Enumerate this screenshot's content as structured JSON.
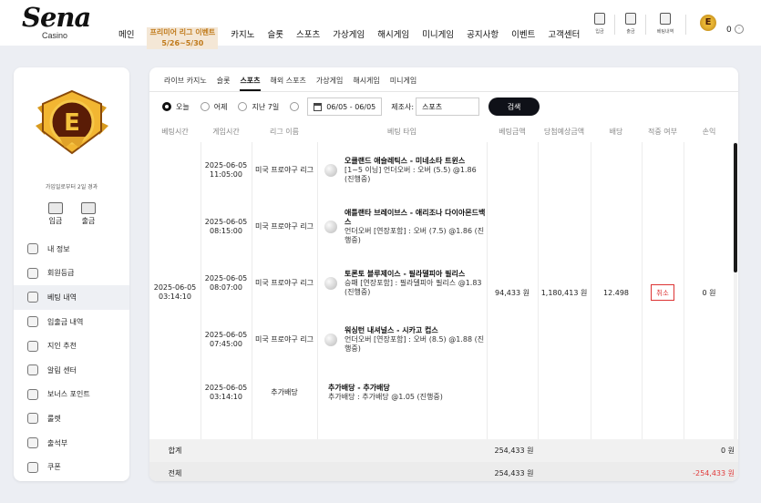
{
  "header": {
    "logo_text": "Sena",
    "logo_sub": "Casino",
    "nav": [
      "메인",
      "프리미어 리그 이벤트 5/26~5/30",
      "카지노",
      "슬롯",
      "스포츠",
      "가상게임",
      "해시게임",
      "미니게임",
      "공지사항",
      "이벤트",
      "고객센터"
    ],
    "promo_line1": "프리미어 리그 이벤트",
    "promo_line2": "5/26~5/30",
    "icons": [
      {
        "icon": "deposit-icon",
        "label": "입금"
      },
      {
        "icon": "withdraw-icon",
        "label": "출금"
      },
      {
        "icon": "betting-history-icon",
        "label": "베팅내역"
      }
    ],
    "badge_letter": "E",
    "balance": "0"
  },
  "sidebar": {
    "emblem_letter": "E",
    "joined_text": "가입일로부터 2일 경과",
    "deposit_label": "입금",
    "withdraw_label": "출금",
    "menu": [
      {
        "label": "내 정보",
        "icon": "profile-icon"
      },
      {
        "label": "회원등급",
        "icon": "grade-icon"
      },
      {
        "label": "베팅 내역",
        "icon": "betting-icon",
        "active": true
      },
      {
        "label": "입출금 내역",
        "icon": "transaction-icon"
      },
      {
        "label": "지인 추천",
        "icon": "referral-icon"
      },
      {
        "label": "알림 센터",
        "icon": "notification-icon"
      },
      {
        "label": "보너스 포인트",
        "icon": "bonus-icon"
      },
      {
        "label": "룰렛",
        "icon": "roulette-icon"
      },
      {
        "label": "출석부",
        "icon": "attendance-icon"
      },
      {
        "label": "쿠폰",
        "icon": "coupon-icon"
      }
    ]
  },
  "tabs": [
    "라이브 카지노",
    "슬롯",
    "스포츠",
    "해외 스포츠",
    "가상게임",
    "해시게임",
    "미니게임"
  ],
  "active_tab": "스포츠",
  "filters": {
    "today": "오늘",
    "yesterday": "어제",
    "last7": "지난 7일",
    "date_range": "06/05 - 06/05",
    "provider_label": "제조사:",
    "provider_value": "스포츠",
    "search_button": "검색"
  },
  "table": {
    "headers": [
      "베팅시간",
      "게임시간",
      "리그 이름",
      "베팅 타입",
      "베팅금액",
      "당첨예상금액",
      "배당",
      "적중 여부",
      "손익"
    ],
    "bet_time": "2025-06-05 03:14:10",
    "bet_amount": "94,433 원",
    "expected_win": "1,180,413 원",
    "odds": "12.498",
    "status_button": "취소",
    "profit": "0 원",
    "rows": [
      {
        "game_time": "2025-06-05 11:05:00",
        "league": "미국 프로야구 리그",
        "title": "오클랜드 애슬레틱스 - 미네소타 트윈스",
        "detail": "[1~5 이닝] 언더오버 : 오버 (5.5) @1.86 (진행중)"
      },
      {
        "game_time": "2025-06-05 08:15:00",
        "league": "미국 프로야구 리그",
        "title": "애틀랜타 브레이브스 - 애리조나 다이아몬드백스",
        "detail": "언더오버 [연장포함] : 오버 (7.5) @1.86 (진행중)"
      },
      {
        "game_time": "2025-06-05 08:07:00",
        "league": "미국 프로야구 리그",
        "title": "토론토 블루제이스 - 필라델피아 필리스",
        "detail": "승패 [연장포함] : 필라델피아 필리스 @1.83 (진행중)"
      },
      {
        "game_time": "2025-06-05 07:45:00",
        "league": "미국 프로야구 리그",
        "title": "워싱턴 내셔널스 - 시카고 컵스",
        "detail": "언더오버 [연장포함] : 오버 (8.5) @1.88 (진행중)"
      },
      {
        "game_time": "2025-06-05 03:14:10",
        "league": "추가배당",
        "title": "추가배당 - 추가배당",
        "detail": "추가배당 : 추가배당 @1.05 (진행중)",
        "no_ball": true
      }
    ],
    "footer": [
      {
        "label": "합계",
        "amount": "254,433 원",
        "result": "0 원",
        "negative": false
      },
      {
        "label": "전체",
        "amount": "254,433 원",
        "result": "-254,433 원",
        "negative": true
      }
    ]
  },
  "colors": {
    "accent": "#0f1118",
    "negative": "#e03a3a",
    "cancel": "#dd3333",
    "promo": "#c07a1a"
  }
}
